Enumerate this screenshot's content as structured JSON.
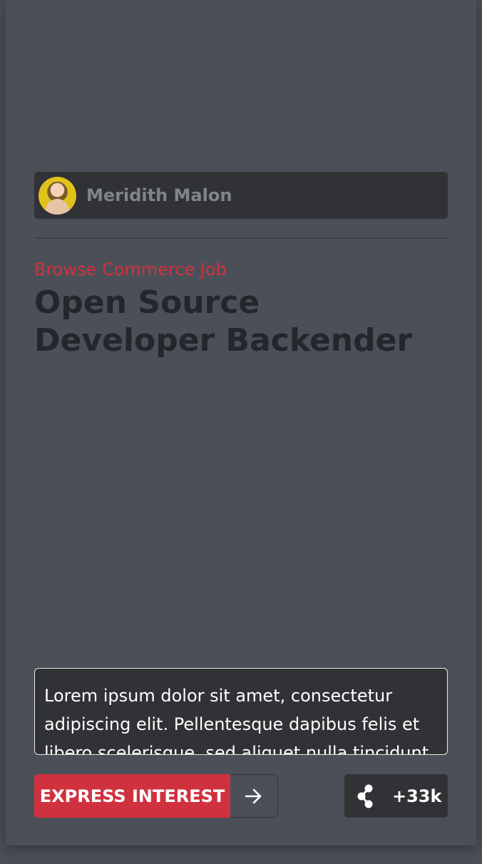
{
  "author": {
    "name": "Meridith Malon",
    "avatar_icon": "avatar-photo"
  },
  "job": {
    "category": "Browse Commerce Job",
    "title": "Open Source Developer Backender",
    "description": "Lorem ipsum dolor sit amet, consectetur adipiscing elit. Pellentesque dapibus felis et libero scelerisque, sed aliquet nulla tincidunt."
  },
  "actions": {
    "express_label": "EXPRESS INTEREST",
    "arrow_icon": "arrow-right-icon",
    "share_icon": "share-icon",
    "share_count": "+33k"
  },
  "colors": {
    "accent": "#d0313f",
    "background": "#4b5058",
    "panel": "#313235",
    "title_text": "#23262b"
  }
}
